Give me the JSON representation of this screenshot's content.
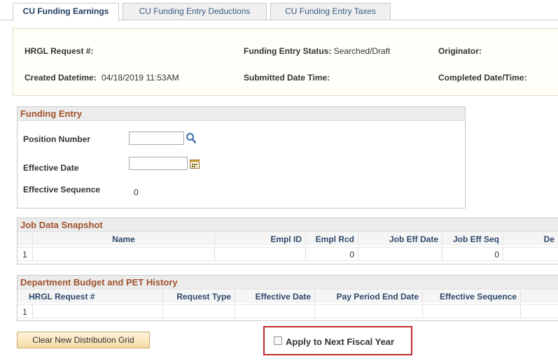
{
  "tabs": [
    {
      "label": "CU Funding Earnings",
      "active": true
    },
    {
      "label": "CU Funding Entry Deductions",
      "active": false
    },
    {
      "label": "CU Funding Entry Taxes",
      "active": false
    }
  ],
  "header": {
    "hrgl_request_label": "HRGL Request #:",
    "funding_status_label": "Funding Entry Status:",
    "funding_status_value": "Searched/Draft",
    "originator_label": "Originator:",
    "created_label": "Created Datetime:",
    "created_value": "04/18/2019 11:53AM",
    "submitted_label": "Submitted Date Time:",
    "completed_label": "Completed Date/Time:"
  },
  "funding_entry": {
    "title": "Funding Entry",
    "position_number_label": "Position Number",
    "position_number_value": "",
    "effective_date_label": "Effective Date",
    "effective_date_value": "",
    "effective_sequence_label": "Effective Sequence",
    "effective_sequence_value": "0"
  },
  "job_data": {
    "title": "Job Data Snapshot",
    "columns": [
      "Name",
      "Empl ID",
      "Empl Rcd",
      "Job Eff Date",
      "Job Eff Seq",
      "De"
    ],
    "rows": [
      {
        "num": "1",
        "name": "",
        "empl_id": "",
        "empl_rcd": "0",
        "job_eff_date": "",
        "job_eff_seq": "0"
      }
    ]
  },
  "dept_budget": {
    "title": "Department Budget and PET History",
    "columns": [
      "HRGL Request #",
      "Request Type",
      "Effective Date",
      "Pay Period End Date",
      "Effective Sequence"
    ],
    "rows": [
      {
        "num": "1"
      }
    ]
  },
  "actions": {
    "clear_button_label": "Clear New Distribution Grid",
    "apply_next_fy_label": "Apply to Next Fiscal Year",
    "apply_next_fy_checked": false
  },
  "colors": {
    "section_title": "#a0522d",
    "header_text": "#2e4a6b",
    "highlight": "#c0282d"
  }
}
